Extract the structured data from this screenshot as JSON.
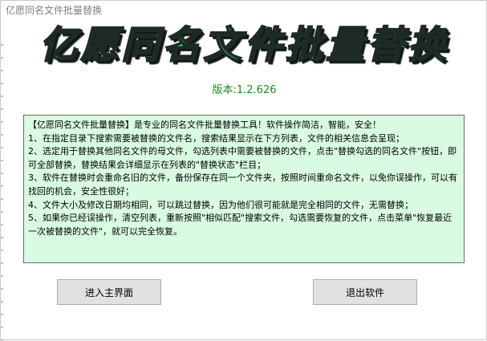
{
  "window": {
    "title": "亿愿同名文件批量替换"
  },
  "banner": {
    "text": "亿愿同名文件批量替换",
    "color": "#3cc68a"
  },
  "version": {
    "label": "版本:",
    "value": "1.2.626"
  },
  "info": {
    "background": "#d9fbe1",
    "lines": [
      "【亿愿同名文件批量替换】是专业的同名文件批量替换工具！软件操作简洁，智能，安全！",
      "1、在指定目录下搜索需要被替换的文件名，搜索结果显示在下方列表，文件的相关信息会呈现；",
      "2、选定用于替换其他同名文件的母文件，勾选列表中需要被替换的文件，点击\"替换勾选的同名文件\"按钮，即可全部替换，替换结果会详细显示在列表的\"替换状态\"栏目；",
      "3、软件在替换时会重命名旧的文件，备份保存在同一个文件夹，按照时间重命名文件，以免你误操作，可以有找回的机会，安全性很好；",
      "4、文件大小及修改日期均相同，可以跳过替换，因为他们很可能就是完全相同的文件，无需替换；",
      "5、如果你已经误操作，清空列表，重新按照\"相似匹配\"搜索文件，勾选需要恢复的文件，点击菜单\"恢复最近一次被替换的文件\"，就可以完全恢复。"
    ]
  },
  "buttons": {
    "enter_label": "进入主界面",
    "exit_label": "退出软件"
  }
}
